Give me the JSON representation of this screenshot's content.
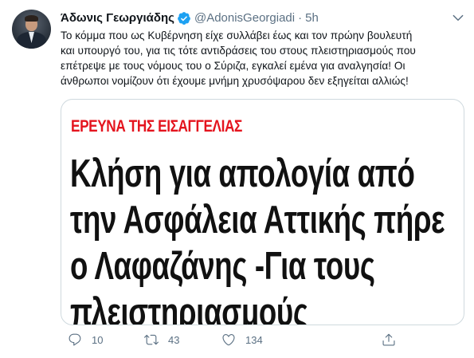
{
  "tweet": {
    "author_name": "Άδωνις Γεωργιάδης",
    "handle": "@AdonisGeorgiadi",
    "separator": "·",
    "time": "5h",
    "text_lines": [
      "Το κόμμα που ως Κυβέρνηση είχε συλλάβει έως και τον πρώην βουλευτή",
      "και υπουργό του, για τις τότε αντιδράσεις του στους πλειστηριασμούς που",
      "επέτρεψε με τους νόμους του ο Σύριζα, εγκαλεί εμένα για αναλγησία! Οι",
      "άνθρωποι νομίζουν ότι έχουμε μνήμη χρυσόψαρου δεν εξηγείται αλλιώς!"
    ],
    "card": {
      "label": "ΕΡΕΥΝΑ ΤΗΣ ΕΙΣΑΓΓΕΛΙΑΣ",
      "headline_lines": [
        "Κλήση για απολογία από",
        "την Ασφάλεια Αττικής πήρε",
        "ο Λαφαζάνης -Για τους",
        "πλειστηριασμούς"
      ]
    },
    "actions": {
      "replies": "10",
      "retweets": "43",
      "likes": "134"
    }
  },
  "colors": {
    "verified_blue": "#1da1f2",
    "muted_text": "#5b7083",
    "card_label_red": "#e4141e",
    "card_border": "#cfd9de"
  },
  "icons": [
    "verified-badge-icon",
    "chevron-down-icon",
    "reply-icon",
    "retweet-icon",
    "like-icon",
    "share-icon"
  ]
}
